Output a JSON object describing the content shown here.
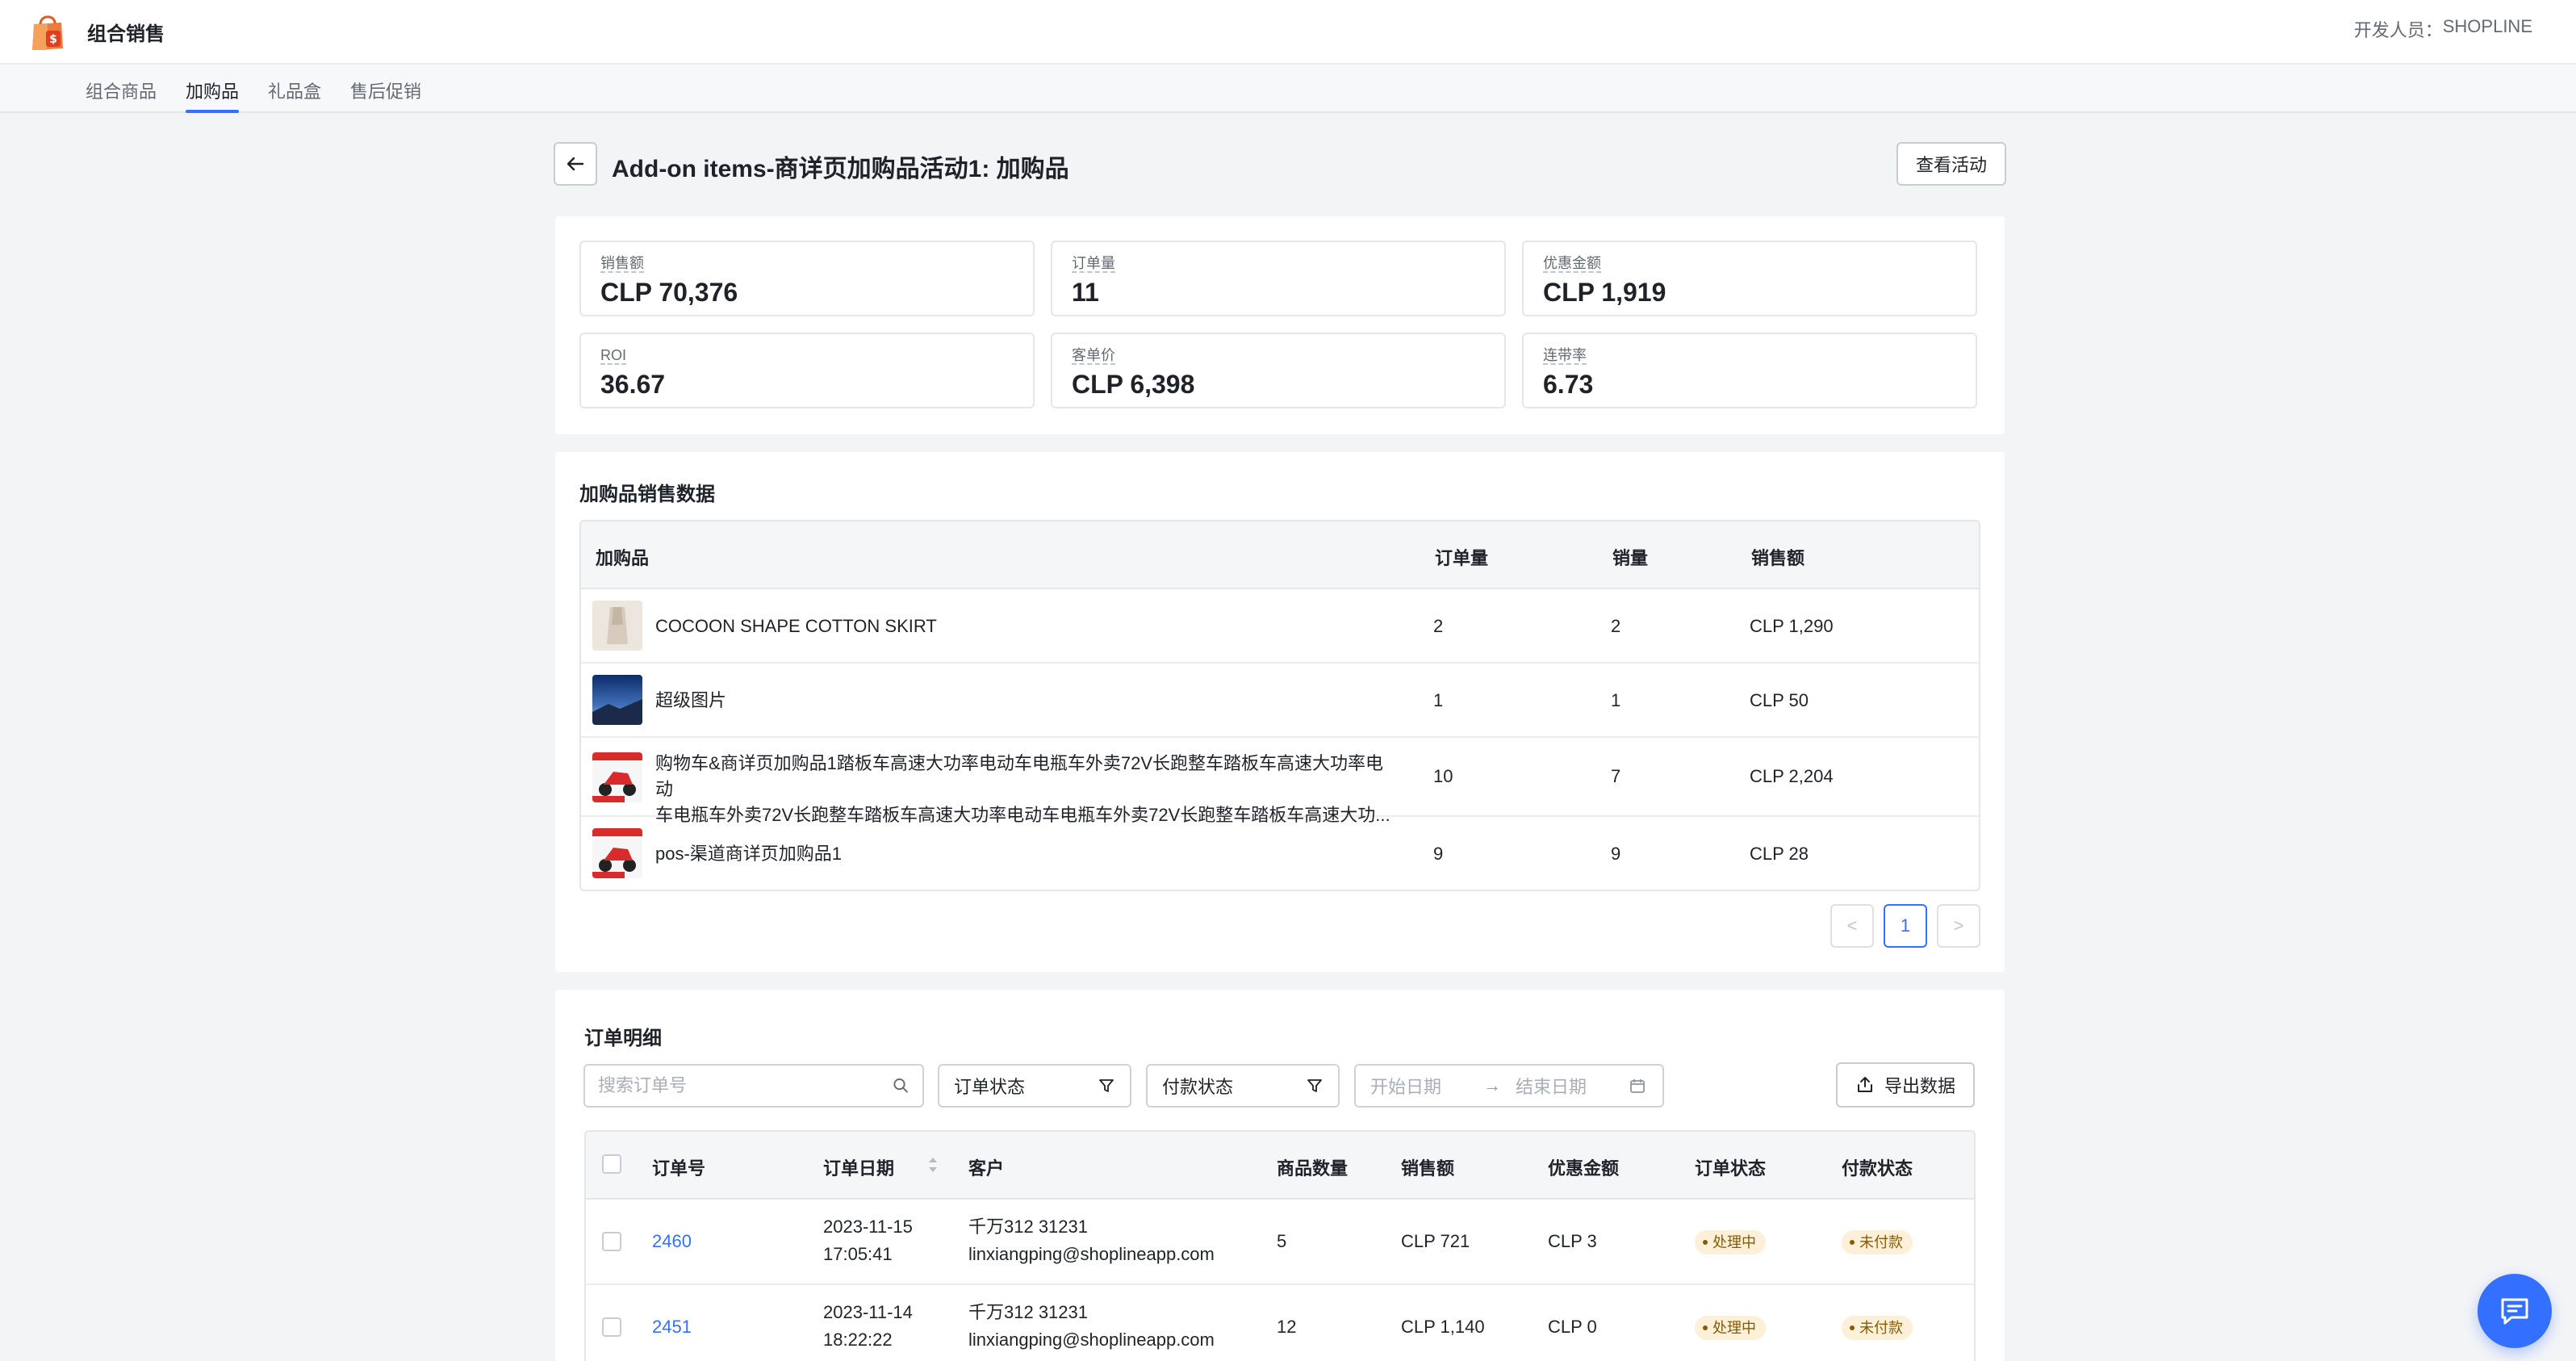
{
  "header": {
    "app_title": "组合销售",
    "developer_label": "开发人员：",
    "developer_name": "SHOPLINE"
  },
  "tabs": [
    {
      "label": "组合商品",
      "active": false
    },
    {
      "label": "加购品",
      "active": true
    },
    {
      "label": "礼品盒",
      "active": false
    },
    {
      "label": "售后促销",
      "active": false
    }
  ],
  "page": {
    "title": "Add-on items-商详页加购品活动1: 加购品",
    "view_button": "查看活动"
  },
  "metrics": [
    {
      "label": "销售额",
      "value": "CLP 70,376"
    },
    {
      "label": "订单量",
      "value": "11"
    },
    {
      "label": "优惠金额",
      "value": "CLP 1,919"
    },
    {
      "label": "ROI",
      "value": "36.67"
    },
    {
      "label": "客单价",
      "value": "CLP 6,398"
    },
    {
      "label": "连带率",
      "value": "6.73"
    }
  ],
  "addon_sales": {
    "title": "加购品销售数据",
    "columns": [
      "加购品",
      "订单量",
      "销量",
      "销售额"
    ],
    "rows": [
      {
        "name": "COCOON SHAPE COTTON SKIRT",
        "orders": "2",
        "qty": "2",
        "amount": "CLP 1,290",
        "thumb": "skirt"
      },
      {
        "name": "超级图片",
        "orders": "1",
        "qty": "1",
        "amount": "CLP 50",
        "thumb": "landscape"
      },
      {
        "name_line1": "购物车&商详页加购品1踏板车高速大功率电动车电瓶车外卖72V长跑整车踏板车高速大功率电动",
        "name_line2": "车电瓶车外卖72V长跑整车踏板车高速大功率电动车电瓶车外卖72V长跑整车踏板车高速大功...",
        "orders": "10",
        "qty": "7",
        "amount": "CLP 2,204",
        "thumb": "scooter"
      },
      {
        "name": "pos-渠道商详页加购品1",
        "orders": "9",
        "qty": "9",
        "amount": "CLP 28",
        "thumb": "scooter"
      }
    ],
    "pagination": {
      "prev": "<",
      "page": "1",
      "next": ">"
    }
  },
  "orders": {
    "title": "订单明细",
    "search_placeholder": "搜索订单号",
    "order_status_filter": "订单状态",
    "payment_status_filter": "付款状态",
    "start_date_placeholder": "开始日期",
    "end_date_placeholder": "结束日期",
    "date_separator": "→",
    "export_button": "导出数据",
    "columns": [
      "订单号",
      "订单日期",
      "客户",
      "商品数量",
      "销售额",
      "优惠金额",
      "订单状态",
      "付款状态"
    ],
    "rows": [
      {
        "id": "2460",
        "date": "2023-11-15",
        "time": "17:05:41",
        "customer": "千万312 31231",
        "email": "linxiangping@shoplineapp.com",
        "qty": "5",
        "amount": "CLP 721",
        "discount": "CLP 3",
        "order_status": "处理中",
        "payment_status": "未付款"
      },
      {
        "id": "2451",
        "date": "2023-11-14",
        "time": "18:22:22",
        "customer": "千万312 31231",
        "email": "linxiangping@shoplineapp.com",
        "qty": "12",
        "amount": "CLP 1,140",
        "discount": "CLP 0",
        "order_status": "处理中",
        "payment_status": "未付款"
      }
    ]
  },
  "colors": {
    "primary": "#3370ff",
    "badge_bg": "#fdf0d9",
    "badge_text": "#8a5a00"
  }
}
